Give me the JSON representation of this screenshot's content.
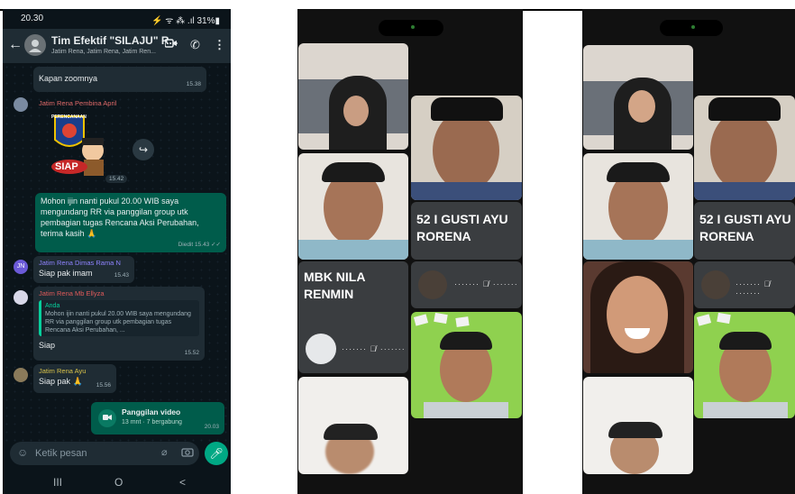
{
  "whatsapp": {
    "status_time": "20.30",
    "status_right": "⚡ ᯤ ⁂ .ıl 31%▮",
    "group_name": "Tim Efektif \"SILAJU\" R...",
    "group_members": "Jatim Rena, Jatim Rena, Jatim Ren...",
    "messages": {
      "m1_text": "Kapan zoomnya",
      "m1_time": "15.38",
      "m2_sender": "Jatim Rena Pembina April",
      "m2_sticker": "SIAP",
      "m2_sticker_top": "PERENCANAAN",
      "m2_time": "15.42",
      "m3_text": "Mohon ijin nanti pukul 20.00 WIB saya mengundang RR via panggilan group utk pembagian tugas Rencana Aksi Perubahan, terima kasih 🙏",
      "m3_meta": "Diedit 15.43 ✓✓",
      "m4_avatar": "JN",
      "m4_sender": "Jatim Rena Dimas Rama N",
      "m4_text": "Siap pak imam",
      "m4_time": "15.43",
      "m5_sender": "Jatim Rena Mb Ellyza",
      "m5_quote_author": "Anda",
      "m5_quote_text": "Mohon ijin nanti pukul 20.00 WIB saya mengundang RR via panggilan group utk pembagian tugas Rencana Aksi Perubahan, ...",
      "m5_text": "Siap",
      "m5_time": "15.52",
      "m6_sender": "Jatim Rena Ayu",
      "m6_text": "Siap pak 🙏",
      "m6_time": "15.56",
      "call_title": "Panggilan video",
      "call_sub": "13 mnt · 7 bergabung",
      "call_time": "20.03"
    },
    "input_placeholder": "Ketik pesan",
    "nav": [
      "III",
      "O",
      "<"
    ]
  },
  "call1": {
    "tile_right_name": "52 I GUSTI AYU RORENA",
    "tile_left_name": "MBK NILA RENMIN",
    "muted_glyph": "·······  🎙̸  ·······"
  },
  "call2": {
    "tile_right_name": "52 I GUSTI AYU RORENA",
    "muted_glyph": "······· 🎙̸ ·······"
  },
  "colors": {
    "wa_bg": "#0b141a",
    "wa_bubble_out": "#005c4b",
    "wa_bubble_in": "#1f2c34",
    "wa_accent": "#00a884"
  }
}
